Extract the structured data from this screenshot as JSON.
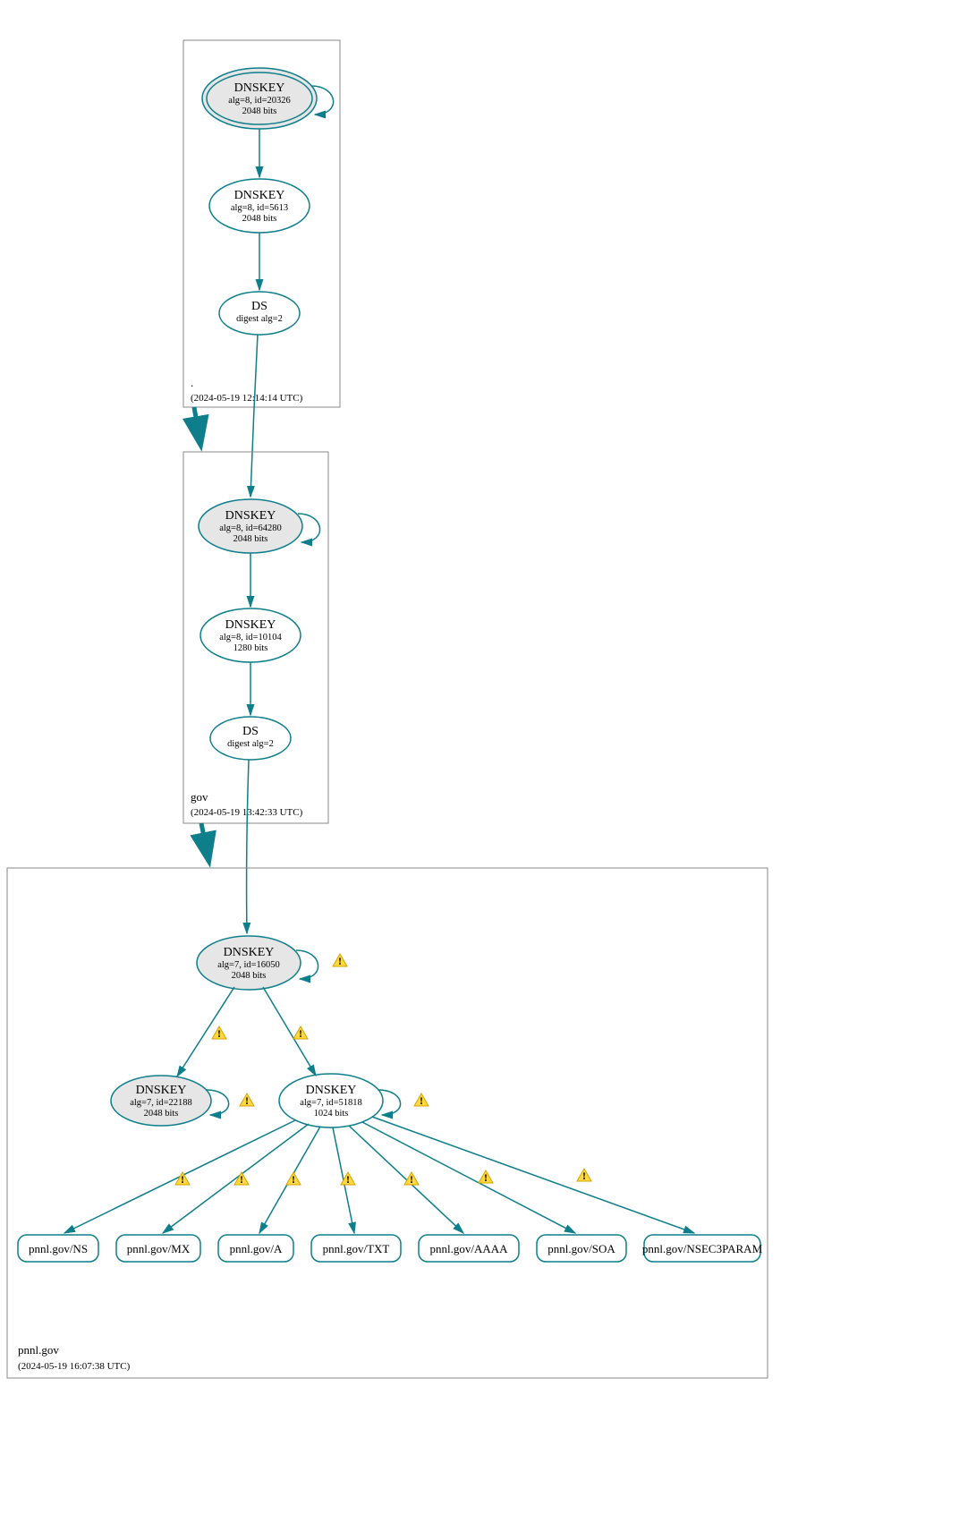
{
  "colors": {
    "teal": "#0d7e8a",
    "grayFill": "#e6e6e6",
    "warnFill": "#ffd83d",
    "warnStroke": "#d4a300"
  },
  "zones": {
    "root": {
      "name": ".",
      "timestamp": "(2024-05-19 12:14:14 UTC)"
    },
    "gov": {
      "name": "gov",
      "timestamp": "(2024-05-19 13:42:33 UTC)"
    },
    "pnnl": {
      "name": "pnnl.gov",
      "timestamp": "(2024-05-19 16:07:38 UTC)"
    }
  },
  "nodes": {
    "root_ksk": {
      "title": "DNSKEY",
      "line2": "alg=8, id=20326",
      "line3": "2048 bits"
    },
    "root_zsk": {
      "title": "DNSKEY",
      "line2": "alg=8, id=5613",
      "line3": "2048 bits"
    },
    "root_ds": {
      "title": "DS",
      "line2": "digest alg=2"
    },
    "gov_ksk": {
      "title": "DNSKEY",
      "line2": "alg=8, id=64280",
      "line3": "2048 bits"
    },
    "gov_zsk": {
      "title": "DNSKEY",
      "line2": "alg=8, id=10104",
      "line3": "1280 bits"
    },
    "gov_ds": {
      "title": "DS",
      "line2": "digest alg=2"
    },
    "pnnl_ksk": {
      "title": "DNSKEY",
      "line2": "alg=7, id=16050",
      "line3": "2048 bits"
    },
    "pnnl_k2": {
      "title": "DNSKEY",
      "line2": "alg=7, id=22188",
      "line3": "2048 bits"
    },
    "pnnl_zsk": {
      "title": "DNSKEY",
      "line2": "alg=7, id=51818",
      "line3": "1024 bits"
    }
  },
  "rrsets": {
    "ns": "pnnl.gov/NS",
    "mx": "pnnl.gov/MX",
    "a": "pnnl.gov/A",
    "txt": "pnnl.gov/TXT",
    "aaaa": "pnnl.gov/AAAA",
    "soa": "pnnl.gov/SOA",
    "nsec": "pnnl.gov/NSEC3PARAM"
  }
}
